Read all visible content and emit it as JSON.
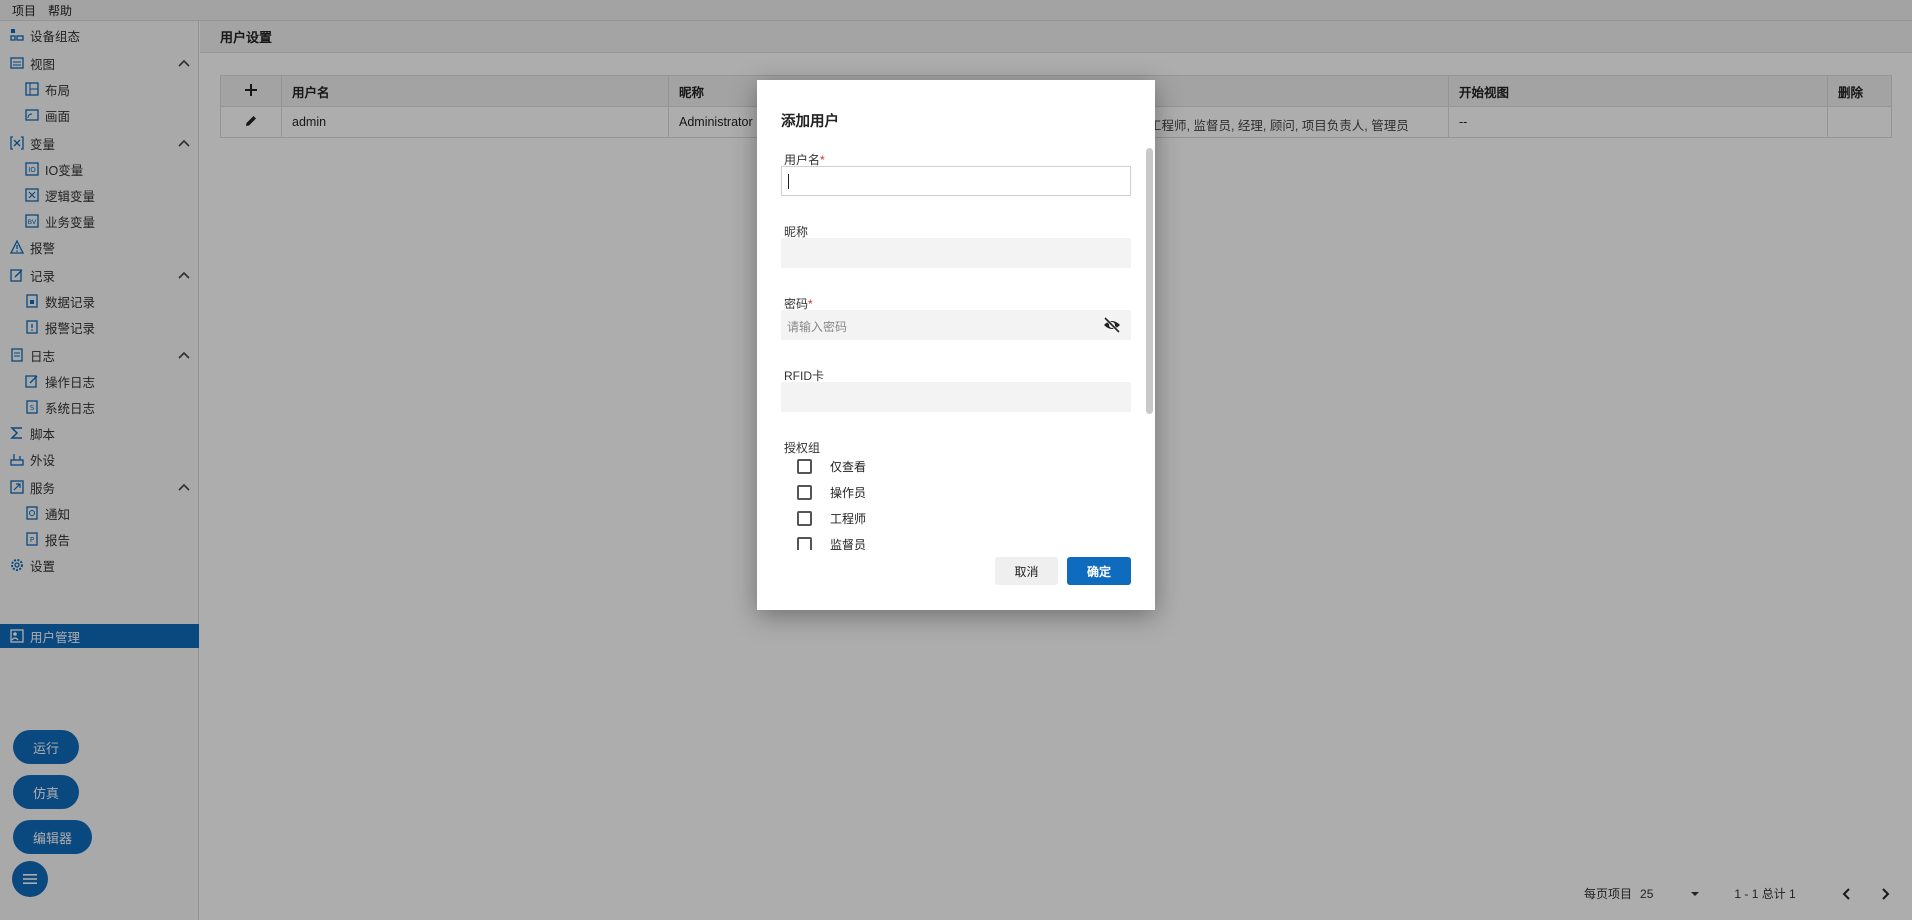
{
  "menubar": {
    "items": [
      "项目",
      "帮助"
    ]
  },
  "sidebar": {
    "items": [
      {
        "label": "设备组态",
        "kind": "top",
        "icon": "device-config-icon"
      },
      {
        "label": "视图",
        "kind": "top",
        "icon": "view-icon",
        "expanded": true
      },
      {
        "label": "布局",
        "kind": "sub",
        "icon": "layout-icon"
      },
      {
        "label": "画面",
        "kind": "sub",
        "icon": "screen-icon"
      },
      {
        "label": "变量",
        "kind": "top",
        "icon": "variable-icon",
        "expanded": true
      },
      {
        "label": "IO变量",
        "kind": "sub",
        "icon": "io-variable-icon"
      },
      {
        "label": "逻辑变量",
        "kind": "sub",
        "icon": "logic-variable-icon"
      },
      {
        "label": "业务变量",
        "kind": "sub",
        "icon": "business-variable-icon"
      },
      {
        "label": "报警",
        "kind": "top",
        "icon": "alarm-icon"
      },
      {
        "label": "记录",
        "kind": "top",
        "icon": "record-icon",
        "expanded": true
      },
      {
        "label": "数据记录",
        "kind": "sub",
        "icon": "data-record-icon"
      },
      {
        "label": "报警记录",
        "kind": "sub",
        "icon": "alarm-record-icon"
      },
      {
        "label": "日志",
        "kind": "top",
        "icon": "log-icon",
        "expanded": true
      },
      {
        "label": "操作日志",
        "kind": "sub",
        "icon": "operation-log-icon"
      },
      {
        "label": "系统日志",
        "kind": "sub",
        "icon": "system-log-icon"
      },
      {
        "label": "脚本",
        "kind": "top",
        "icon": "script-icon"
      },
      {
        "label": "外设",
        "kind": "top",
        "icon": "peripheral-icon"
      },
      {
        "label": "服务",
        "kind": "top",
        "icon": "service-icon",
        "expanded": true
      },
      {
        "label": "通知",
        "kind": "sub",
        "icon": "notification-icon"
      },
      {
        "label": "报告",
        "kind": "sub",
        "icon": "report-icon"
      },
      {
        "label": "设置",
        "kind": "top",
        "icon": "settings-gear-icon"
      },
      {
        "label": "用户管理",
        "kind": "top",
        "icon": "user-management-icon",
        "active": true
      }
    ],
    "actions": {
      "run": "运行",
      "simulate": "仿真",
      "editor": "编辑器"
    }
  },
  "page": {
    "title": "用户设置",
    "table": {
      "columns": [
        "用户名",
        "昵称",
        "开始视图",
        "删除"
      ],
      "rows": [
        {
          "username": "admin",
          "nickname": "Administrator",
          "groups": "工程师, 监督员, 经理, 顾问, 项目负责人, 管理员",
          "start_view": "--"
        }
      ]
    },
    "pager": {
      "per_page_label": "每页项目",
      "per_page_value": "25",
      "range": "1 - 1 总计 1"
    }
  },
  "dialog": {
    "title": "添加用户",
    "username_label": "用户名",
    "username_value": "",
    "nickname_label": "昵称",
    "password_label": "密码",
    "password_placeholder": "请输入密码",
    "rfid_label": "RFID卡",
    "groups_label": "授权组",
    "groups": [
      "仅查看",
      "操作员",
      "工程师",
      "监督员"
    ],
    "cancel": "取消",
    "ok": "确定"
  },
  "colors": {
    "accent": "#0f6bbd",
    "required": "#d32f2f"
  }
}
